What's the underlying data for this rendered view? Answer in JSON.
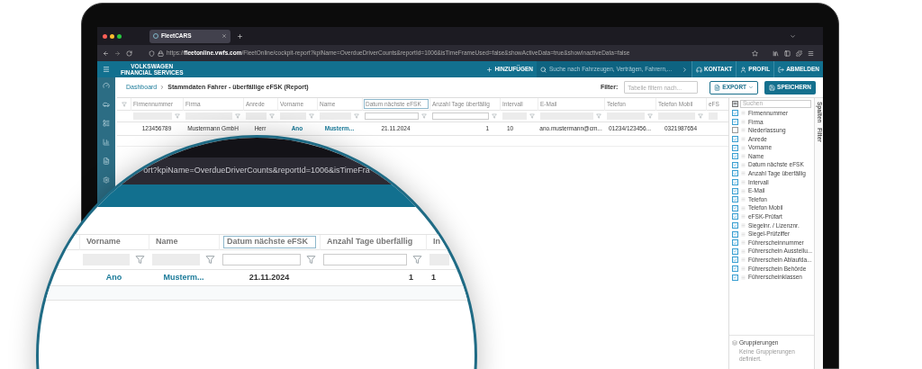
{
  "browser": {
    "tab_title": "FleetCARS",
    "url": "https://**fleetonline.vwfs.com**/FleetOnline/cockpit-report?kpiName=OverdueDriverCounts&reportId=1006&isTimeFrameUsed=false&showActiveData=true&showInactiveData=false"
  },
  "app_header": {
    "logo_lines": [
      "VOLKSWAGEN",
      "FINANCIAL SERVICES"
    ],
    "add_button": "HINZUFÜGEN",
    "search_placeholder": "Suche nach Fahrzeugen, Verträgen, Fahrern,...",
    "nav": [
      {
        "label": "KONTAKT",
        "kind": "contact"
      },
      {
        "label": "PROFIL",
        "kind": "profile"
      },
      {
        "label": "ABMELDEN",
        "kind": "logout"
      }
    ]
  },
  "breadcrumb": {
    "link": "Dashboard",
    "current": "Stammdaten Fahrer - überfällige eFSK (Report)"
  },
  "filter": {
    "label": "Filter:",
    "placeholder": "Tabelle filtern nach..."
  },
  "buttons": [
    {
      "label": "EXPORT",
      "kind": "dropdown"
    },
    {
      "label": "SPEICHERN",
      "kind": "primary"
    }
  ],
  "table": {
    "columns": [
      {
        "label": "Firmennummer",
        "focused": false,
        "filter_active": false,
        "link": false
      },
      {
        "label": "Firma",
        "focused": false,
        "filter_active": false,
        "link": false
      },
      {
        "label": "Anrede",
        "focused": false,
        "filter_active": false,
        "link": false
      },
      {
        "label": "Vorname",
        "focused": false,
        "filter_active": false,
        "link": true
      },
      {
        "label": "Name",
        "focused": false,
        "filter_active": false,
        "link": true
      },
      {
        "label": "Datum nächste eFSK",
        "focused": true,
        "filter_active": true,
        "link": false
      },
      {
        "label": "Anzahl Tage überfällig",
        "focused": false,
        "filter_active": true,
        "link": false
      },
      {
        "label": "Intervall",
        "focused": false,
        "filter_active": false,
        "link": false
      },
      {
        "label": "E-Mail",
        "focused": false,
        "filter_active": false,
        "link": false
      },
      {
        "label": "Telefon",
        "focused": false,
        "filter_active": false,
        "link": false
      },
      {
        "label": "Telefon Mobil",
        "focused": false,
        "filter_active": false,
        "link": false
      },
      {
        "label": "eFS",
        "focused": false,
        "filter_active": false
      }
    ],
    "rows": [
      [
        "123456789",
        "Mustermann GmbH",
        "Herr",
        "Ano",
        "Musterm...",
        "21.11.2024",
        "1",
        "10",
        "ano.mustermann@cm...",
        "01234/123456...",
        "0321987654"
      ]
    ]
  },
  "column_panel": {
    "select_all": {
      "checked": false,
      "indeterminate": true
    },
    "search_placeholder": "Suchen",
    "items": [
      {
        "label": "Firmennummer",
        "checked": true
      },
      {
        "label": "Firma",
        "checked": true
      },
      {
        "label": "Niederlassung",
        "checked": false
      },
      {
        "label": "Anrede",
        "checked": true
      },
      {
        "label": "Vorname",
        "checked": true
      },
      {
        "label": "Name",
        "checked": true
      },
      {
        "label": "Datum nächste eFSK",
        "checked": true
      },
      {
        "label": "Anzahl Tage überfällig",
        "checked": true
      },
      {
        "label": "Intervall",
        "checked": true
      },
      {
        "label": "E-Mail",
        "checked": true
      },
      {
        "label": "Telefon",
        "checked": true
      },
      {
        "label": "Telefon Mobil",
        "checked": true
      },
      {
        "label": "eFSK-Prüfart",
        "checked": true
      },
      {
        "label": "Siegelnr. / Lizenznr.",
        "checked": true
      },
      {
        "label": "Siegel-Prüfziffer",
        "checked": true
      },
      {
        "label": "Führerscheinnummer",
        "checked": true
      },
      {
        "label": "Führerschein Ausstellu...",
        "checked": true
      },
      {
        "label": "Führerschein Ablaufda...",
        "checked": true
      },
      {
        "label": "Führerschein Behörde",
        "checked": true
      },
      {
        "label": "Führerscheinklassen",
        "checked": true
      }
    ],
    "grouping_title": "Gruppierungen",
    "grouping_text": "Keine Gruppierungen definiert.",
    "side_tabs": [
      "Spalten",
      "Filter"
    ]
  },
  "magnifier": {
    "url_fragment": "ort?kpiName=OverdueDriverCounts&reportId=1006&isTimeFra",
    "columns": [
      {
        "label": "Vorname",
        "focused": false,
        "filter_active": false,
        "link": true
      },
      {
        "label": "Name",
        "focused": false,
        "filter_active": false,
        "link": true
      },
      {
        "label": "Datum nächste eFSK",
        "focused": true,
        "filter_active": true,
        "link": false
      },
      {
        "label": "Anzahl Tage überfällig",
        "focused": false,
        "filter_active": true,
        "link": false
      },
      {
        "label": "In",
        "focused": false,
        "filter_active": false,
        "link": false
      }
    ],
    "row": [
      "Ano",
      "Musterm...",
      "21.11.2024",
      "1",
      "1"
    ]
  }
}
